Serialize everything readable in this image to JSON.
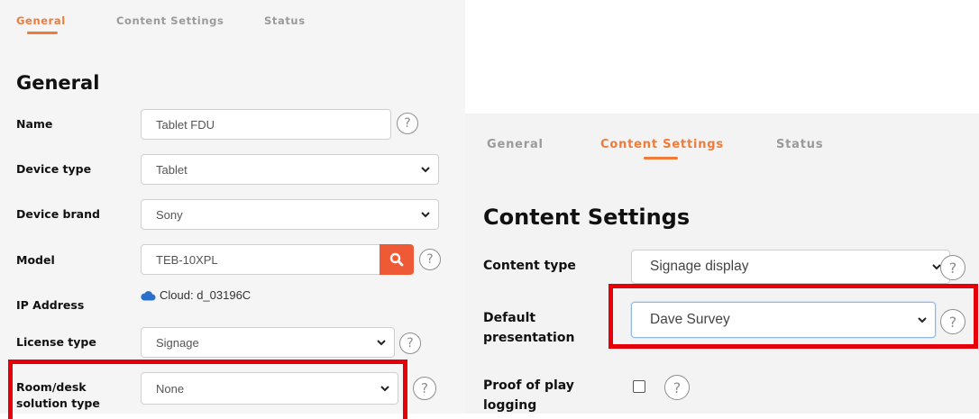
{
  "left": {
    "tabs": [
      {
        "label": "General",
        "active": true
      },
      {
        "label": "Content Settings",
        "active": false
      },
      {
        "label": "Status",
        "active": false
      }
    ],
    "heading": "General",
    "fields": {
      "name": {
        "label": "Name",
        "value": "Tablet FDU"
      },
      "device_type": {
        "label": "Device type",
        "value": "Tablet"
      },
      "device_brand": {
        "label": "Device brand",
        "value": "Sony"
      },
      "model": {
        "label": "Model",
        "value": "TEB-10XPL"
      },
      "ip_address": {
        "label": "IP Address",
        "value": "Cloud: d_03196C"
      },
      "license_type": {
        "label": "License type",
        "value": "Signage"
      },
      "room_desk": {
        "label_line1": "Room/desk",
        "label_line2": "solution type",
        "value": "None"
      }
    }
  },
  "right": {
    "tabs": [
      {
        "label": "General",
        "active": false
      },
      {
        "label": "Content Settings",
        "active": true
      },
      {
        "label": "Status",
        "active": false
      }
    ],
    "heading": "Content Settings",
    "fields": {
      "content_type": {
        "label": "Content type",
        "value": "Signage display"
      },
      "default_presentation": {
        "label_line1": "Default",
        "label_line2": "presentation",
        "value": "Dave Survey"
      },
      "proof_of_play": {
        "label_line1": "Proof of play",
        "label_line2": "logging",
        "checked": false
      }
    }
  },
  "help_symbol": "?",
  "icons": {
    "help": "question-circle-icon",
    "search": "magnifier-icon",
    "chevron": "chevron-down-icon",
    "cloud": "cloud-icon"
  },
  "colors": {
    "accent": "#f07b38",
    "search_button": "#ee5a35",
    "highlight": "#e6000a",
    "cloud": "#2a6fc9"
  }
}
